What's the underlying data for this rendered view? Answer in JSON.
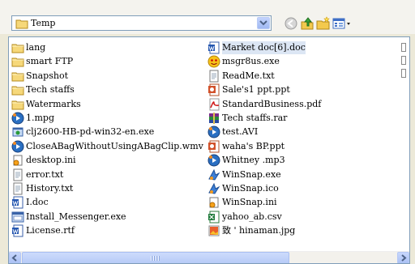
{
  "location": {
    "current_folder": "Temp",
    "folder_icon": "folder-icon"
  },
  "toolbar": {
    "buttons": [
      {
        "name": "back-icon"
      },
      {
        "name": "up-folder-icon"
      },
      {
        "name": "new-folder-icon"
      },
      {
        "name": "view-menu-icon"
      }
    ]
  },
  "files": {
    "column1": [
      {
        "label": "lang",
        "icon": "folder-icon"
      },
      {
        "label": "smart FTP",
        "icon": "folder-icon"
      },
      {
        "label": "Snapshot",
        "icon": "folder-icon"
      },
      {
        "label": "Tech staffs",
        "icon": "folder-icon"
      },
      {
        "label": "Watermarks",
        "icon": "folder-icon"
      },
      {
        "label": "1.mpg",
        "icon": "media-file-icon"
      },
      {
        "label": "clj2600-HB-pd-win32-en.exe",
        "icon": "setup-exe-icon"
      },
      {
        "label": "CloseABagWithoutUsingABagClip.wmv",
        "icon": "media-file-icon"
      },
      {
        "label": "desktop.ini",
        "icon": "ini-settings-icon"
      },
      {
        "label": "error.txt",
        "icon": "text-file-icon"
      },
      {
        "label": "History.txt",
        "icon": "text-file-icon"
      },
      {
        "label": "I.doc",
        "icon": "word-doc-icon"
      },
      {
        "label": "Install_Messenger.exe",
        "icon": "installer-exe-icon"
      },
      {
        "label": "License.rtf",
        "icon": "word-doc-icon"
      }
    ],
    "column2": [
      {
        "label": "Market doc[6].doc",
        "icon": "word-doc-icon",
        "selected": true
      },
      {
        "label": "msgr8us.exe",
        "icon": "messenger-icon"
      },
      {
        "label": "ReadMe.txt",
        "icon": "text-file-icon"
      },
      {
        "label": "Sale's1 ppt.ppt",
        "icon": "powerpoint-icon"
      },
      {
        "label": "StandardBusiness.pdf",
        "icon": "pdf-icon"
      },
      {
        "label": "Tech staffs.rar",
        "icon": "rar-archive-icon"
      },
      {
        "label": "test.AVI",
        "icon": "media-file-icon"
      },
      {
        "label": "waha's BP.ppt",
        "icon": "powerpoint-icon"
      },
      {
        "label": "Whitney .mp3",
        "icon": "media-file-icon"
      },
      {
        "label": "WinSnap.exe",
        "icon": "winsnap-icon"
      },
      {
        "label": "WinSnap.ico",
        "icon": "winsnap-icon"
      },
      {
        "label": "WinSnap.ini",
        "icon": "ini-settings-icon"
      },
      {
        "label": "yahoo_ab.csv",
        "icon": "excel-csv-icon"
      },
      {
        "label": "致 ' hinaman.jpg",
        "icon": "image-file-icon"
      }
    ]
  },
  "colors": {
    "background": "#ece9d8",
    "border": "#7f9db9",
    "selection": "#dce6f4"
  }
}
